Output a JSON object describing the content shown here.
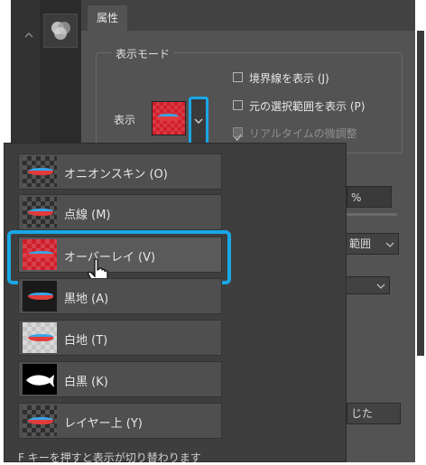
{
  "panel": {
    "tab_label": "属性"
  },
  "mode": {
    "group_label": "表示モード",
    "show_label": "表示",
    "options": {
      "show_border": "境界線を表示 (J)",
      "show_original": "元の選択範囲を表示 (P)",
      "realtime": "リアルタイムの微調整"
    }
  },
  "right_controls": {
    "percent": "%",
    "range": "範囲",
    "done": "じた"
  },
  "menu": {
    "items": [
      {
        "label": "オニオンスキン (O)",
        "thumb": "checker-fish"
      },
      {
        "label": "点線 (M)",
        "thumb": "checker-fish"
      },
      {
        "label": "オーバーレイ (V)",
        "thumb": "red-fish"
      },
      {
        "label": "黒地 (A)",
        "thumb": "dark-fish"
      },
      {
        "label": "白地 (T)",
        "thumb": "white-fish"
      },
      {
        "label": "白黒 (K)",
        "thumb": "bw-fish"
      },
      {
        "label": "レイヤー上 (Y)",
        "thumb": "checker-fish"
      }
    ],
    "footer": "F キーを押すと表示が切り替わります"
  },
  "colors": {
    "highlight": "#19a7e6",
    "overlay_red": "#cf1f2b"
  }
}
